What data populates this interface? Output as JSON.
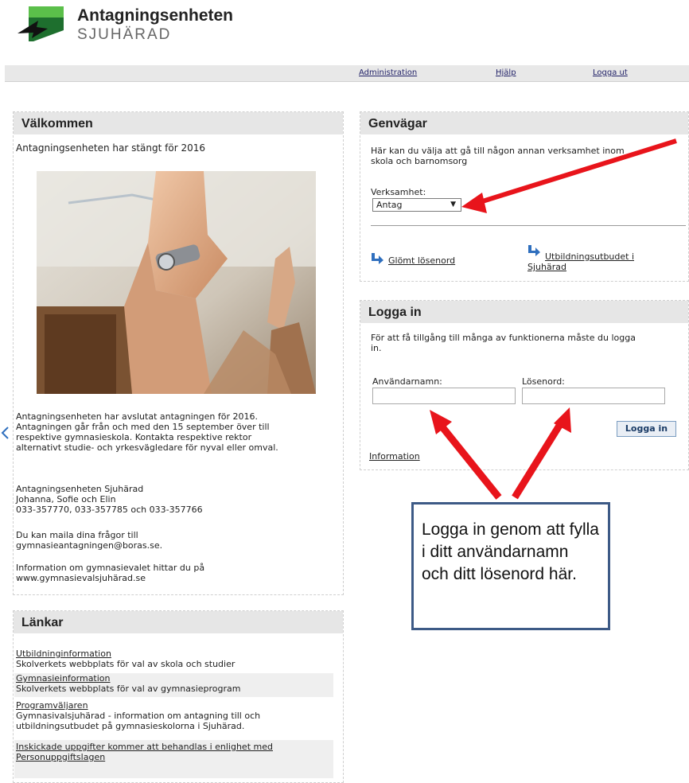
{
  "logo": {
    "title": "Antagningsenheten",
    "subtitle": "SJUHÄRAD"
  },
  "nav": {
    "administration": "Administration",
    "help": "Hjälp",
    "logout": "Logga ut"
  },
  "welcome": {
    "title": "Välkommen",
    "closed_text": "Antagningsenheten har stängt för 2016",
    "para1": [
      "Antagningsenheten har avslutat antagningen för 2016.",
      "Antagningen går från och med den 15 september över till",
      "respektive gymnasieskola. Kontakta respektive rektor",
      "alternativt studie- och yrkesvägledare för nyval eller omval."
    ],
    "contact": [
      "Antagningsenheten Sjuhärad",
      "Johanna, Sofie och Elin",
      "033-357770, 033-357785 och 033-357766"
    ],
    "mail": [
      "Du kan maila dina frågor till",
      "gymnasieantagningen@boras.se."
    ],
    "info": [
      "Information om gymnasievalet hittar du på",
      "www.gymnasievalsjuhärad.se"
    ]
  },
  "links": {
    "title": "Länkar",
    "items": [
      {
        "link": "Utbildninginformation",
        "desc": "Skolverkets webbplats för val av skola och studier"
      },
      {
        "link": "Gymnasieinformation",
        "desc": "Skolverkets webbplats för val av gymnasieprogram"
      },
      {
        "link": "Programväljaren",
        "desc": [
          "Gymnasivalsjuhärad - information om antagning till och",
          "utbildningsutbudet på gymnasieskolorna i Sjuhärad."
        ]
      },
      {
        "link": [
          "Inskickade uppgifter kommer att behandlas i enlighet med",
          "Personuppgiftslagen"
        ]
      }
    ]
  },
  "shortcuts": {
    "title": "Genvägar",
    "intro": [
      "Här kan du välja att gå till någon annan verksamhet inom",
      "skola och barnomsorg"
    ],
    "label": "Verksamhet:",
    "selected": "Antag",
    "forgot": "Glömt lösenord",
    "offer": [
      "Utbildningsutbudet i",
      "Sjuhärad"
    ]
  },
  "login": {
    "title": "Logga in",
    "intro": [
      "För att få tillgång till många av funktionerna måste du logga",
      "in."
    ],
    "username_label": "Användarnamn:",
    "password_label": "Lösenord:",
    "button": "Logga in",
    "info_link": "Information"
  },
  "callout": {
    "text": "Logga in genom att fylla i ditt användarnamn och ditt lösenord här."
  },
  "colors": {
    "arrow": "#e8141b",
    "callout_border": "#3d5a86",
    "header_bg": "#e6e6e6"
  }
}
